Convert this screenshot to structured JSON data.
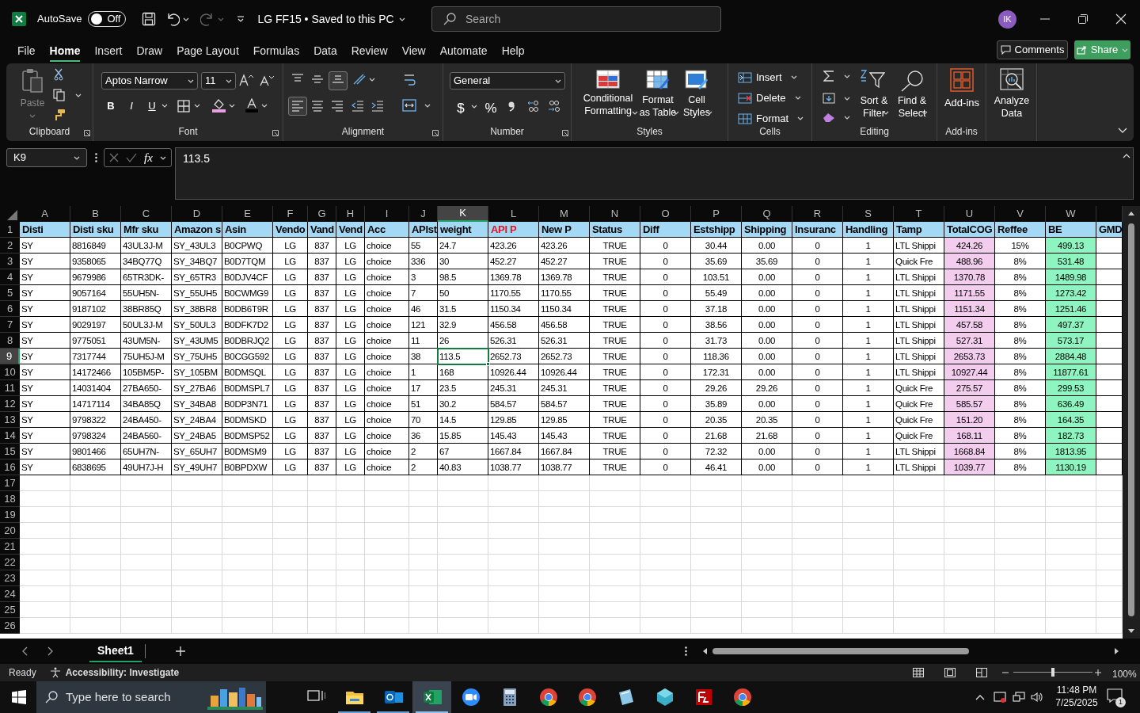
{
  "title_bar": {
    "autosave_label": "AutoSave",
    "autosave": {
      "label": "Off",
      "on": false
    },
    "document_title": "LG FF15 • Saved to this PC",
    "search_placeholder": "Search",
    "user_initials": "IK"
  },
  "menu_tabs": [
    {
      "label": "File",
      "selected": false
    },
    {
      "label": "Home",
      "selected": true
    },
    {
      "label": "Insert",
      "selected": false
    },
    {
      "label": "Draw",
      "selected": false
    },
    {
      "label": "Page Layout",
      "selected": false
    },
    {
      "label": "Formulas",
      "selected": false
    },
    {
      "label": "Data",
      "selected": false
    },
    {
      "label": "Review",
      "selected": false
    },
    {
      "label": "View",
      "selected": false
    },
    {
      "label": "Automate",
      "selected": false
    },
    {
      "label": "Help",
      "selected": false
    }
  ],
  "comments_button": "Comments",
  "share_button": "Share",
  "ribbon": {
    "clipboard": {
      "paste": "Paste",
      "label": "Clipboard"
    },
    "font": {
      "name": "Aptos Narrow",
      "size": "11",
      "bold": "B",
      "italic": "I",
      "underline": "U",
      "label": "Font"
    },
    "alignment": {
      "label": "Alignment"
    },
    "number": {
      "format": "General",
      "currency": "$",
      "percent": "%",
      "label": "Number"
    },
    "styles": {
      "buttons": [
        "Conditional Formatting",
        "Format as Table",
        "Cell Styles"
      ],
      "label": "Styles"
    },
    "cells": {
      "buttons": [
        "Insert",
        "Delete",
        "Format"
      ],
      "label": "Cells"
    },
    "editing": {
      "buttons": [
        "Sort & Filter",
        "Find & Select"
      ],
      "label": "Editing"
    },
    "addins": {
      "buttons": [
        "Add-ins"
      ],
      "label": "Add-ins"
    },
    "analyze": {
      "buttons": [
        "Analyze Data"
      ]
    }
  },
  "formula_bar": {
    "name_box": "K9",
    "function_label": "fx",
    "value": "113.5"
  },
  "sheet": {
    "heading_row_number": "1",
    "columns": [
      {
        "letter": "A",
        "heading": "Disti",
        "selected": false
      },
      {
        "letter": "B",
        "heading": "Disti sku",
        "selected": false
      },
      {
        "letter": "C",
        "heading": "Mfr sku",
        "selected": false
      },
      {
        "letter": "D",
        "heading": "Amazon s",
        "selected": false
      },
      {
        "letter": "E",
        "heading": "Asin",
        "selected": false
      },
      {
        "letter": "F",
        "heading": "Vendo",
        "selected": false
      },
      {
        "letter": "G",
        "heading": "Vand",
        "selected": false
      },
      {
        "letter": "H",
        "heading": "Vend",
        "selected": false
      },
      {
        "letter": "I",
        "heading": "Acc",
        "selected": false
      },
      {
        "letter": "J",
        "heading": "APIst",
        "selected": false
      },
      {
        "letter": "K",
        "heading": "weight",
        "selected": true
      },
      {
        "letter": "L",
        "heading": "API P",
        "selected": false,
        "highlighted": true
      },
      {
        "letter": "M",
        "heading": "New P",
        "selected": false
      },
      {
        "letter": "N",
        "heading": "Status",
        "selected": false
      },
      {
        "letter": "O",
        "heading": "Diff",
        "selected": false
      },
      {
        "letter": "P",
        "heading": "Estshipp",
        "selected": false
      },
      {
        "letter": "Q",
        "heading": "Shipping",
        "selected": false
      },
      {
        "letter": "R",
        "heading": "Insuranc",
        "selected": false
      },
      {
        "letter": "S",
        "heading": "Handling",
        "selected": false
      },
      {
        "letter": "T",
        "heading": "Tamp",
        "selected": false
      },
      {
        "letter": "U",
        "heading": "TotalCOG",
        "selected": false,
        "color": "#f2cdee"
      },
      {
        "letter": "V",
        "heading": "Reffee",
        "selected": false
      },
      {
        "letter": "W",
        "heading": "BE",
        "selected": false,
        "color": "#8ef5c0"
      },
      {
        "heading": "GMD",
        "selected": false
      }
    ],
    "rows": [
      {
        "number": "2",
        "selected": false,
        "cells": [
          "SY",
          "8816849",
          "43UL3J-M",
          "SY_43UL3",
          "B0CPWQ",
          "LG",
          "837",
          "LG",
          "choice",
          "55",
          "24.7",
          "423.26",
          "423.26",
          "TRUE",
          "0",
          "30.44",
          "0.00",
          "0",
          "1",
          "LTL Shippi",
          "424.26",
          "15%",
          "499.13"
        ]
      },
      {
        "number": "3",
        "selected": false,
        "cells": [
          "SY",
          "9358065",
          "34BQ77Q",
          "SY_34BQ7",
          "B0D7TQM",
          "LG",
          "837",
          "LG",
          "choice",
          "336",
          "30",
          "452.27",
          "452.27",
          "TRUE",
          "0",
          "35.69",
          "35.69",
          "0",
          "1",
          "Quick Fre",
          "488.96",
          "8%",
          "531.48"
        ]
      },
      {
        "number": "4",
        "selected": false,
        "cells": [
          "SY",
          "9679986",
          "65TR3DK-",
          "SY_65TR3",
          "B0DJV4CF",
          "LG",
          "837",
          "LG",
          "choice",
          "3",
          "98.5",
          "1369.78",
          "1369.78",
          "TRUE",
          "0",
          "103.51",
          "0.00",
          "0",
          "1",
          "LTL Shippi",
          "1370.78",
          "8%",
          "1489.98"
        ]
      },
      {
        "number": "5",
        "selected": false,
        "cells": [
          "SY",
          "9057164",
          "55UH5N-",
          "SY_55UH5",
          "B0CWMG9",
          "LG",
          "837",
          "LG",
          "choice",
          "7",
          "50",
          "1170.55",
          "1170.55",
          "TRUE",
          "0",
          "55.49",
          "0.00",
          "0",
          "1",
          "LTL Shippi",
          "1171.55",
          "8%",
          "1273.42"
        ]
      },
      {
        "number": "6",
        "selected": false,
        "cells": [
          "SY",
          "9187102",
          "38BR85Q",
          "SY_38BR8",
          "B0DB6T9R",
          "LG",
          "837",
          "LG",
          "choice",
          "46",
          "31.5",
          "1150.34",
          "1150.34",
          "TRUE",
          "0",
          "37.18",
          "0.00",
          "0",
          "1",
          "LTL Shippi",
          "1151.34",
          "8%",
          "1251.46"
        ]
      },
      {
        "number": "7",
        "selected": false,
        "cells": [
          "SY",
          "9029197",
          "50UL3J-M",
          "SY_50UL3",
          "B0DFK7D2",
          "LG",
          "837",
          "LG",
          "choice",
          "121",
          "32.9",
          "456.58",
          "456.58",
          "TRUE",
          "0",
          "38.56",
          "0.00",
          "0",
          "1",
          "LTL Shippi",
          "457.58",
          "8%",
          "497.37"
        ]
      },
      {
        "number": "8",
        "selected": false,
        "cells": [
          "SY",
          "9775051",
          "43UM5N-",
          "SY_43UM5",
          "B0DBRJQ2",
          "LG",
          "837",
          "LG",
          "choice",
          "11",
          "26",
          "526.31",
          "526.31",
          "TRUE",
          "0",
          "31.73",
          "0.00",
          "0",
          "1",
          "LTL Shippi",
          "527.31",
          "8%",
          "573.17"
        ]
      },
      {
        "number": "9",
        "selected": true,
        "cells": [
          "SY",
          "7317744",
          "75UH5J-M",
          "SY_75UH5",
          "B0CGG592",
          "LG",
          "837",
          "LG",
          "choice",
          "38",
          "113.5",
          "2652.73",
          "2652.73",
          "TRUE",
          "0",
          "118.36",
          "0.00",
          "0",
          "1",
          "LTL Shippi",
          "2653.73",
          "8%",
          "2884.48"
        ]
      },
      {
        "number": "10",
        "selected": false,
        "cells": [
          "SY",
          "14172466",
          "105BM5P-",
          "SY_105BM",
          "B0DMSQL",
          "LG",
          "837",
          "LG",
          "choice",
          "1",
          "168",
          "10926.44",
          "10926.44",
          "TRUE",
          "0",
          "172.31",
          "0.00",
          "0",
          "1",
          "LTL Shippi",
          "10927.44",
          "8%",
          "11877.61"
        ]
      },
      {
        "number": "11",
        "selected": false,
        "cells": [
          "SY",
          "14031404",
          "27BA650-",
          "SY_27BA6",
          "B0DMSPL7",
          "LG",
          "837",
          "LG",
          "choice",
          "17",
          "23.5",
          "245.31",
          "245.31",
          "TRUE",
          "0",
          "29.26",
          "29.26",
          "0",
          "1",
          "Quick Fre",
          "275.57",
          "8%",
          "299.53"
        ]
      },
      {
        "number": "12",
        "selected": false,
        "cells": [
          "SY",
          "14717114",
          "34BA85Q",
          "SY_34BA8",
          "B0DP3N71",
          "LG",
          "837",
          "LG",
          "choice",
          "51",
          "30.2",
          "584.57",
          "584.57",
          "TRUE",
          "0",
          "35.89",
          "0.00",
          "0",
          "1",
          "Quick Fre",
          "585.57",
          "8%",
          "636.49"
        ]
      },
      {
        "number": "13",
        "selected": false,
        "cells": [
          "SY",
          "9798322",
          "24BA450-",
          "SY_24BA4",
          "B0DMSKD",
          "LG",
          "837",
          "LG",
          "choice",
          "70",
          "14.5",
          "129.85",
          "129.85",
          "TRUE",
          "0",
          "20.35",
          "20.35",
          "0",
          "1",
          "Quick Fre",
          "151.20",
          "8%",
          "164.35"
        ]
      },
      {
        "number": "14",
        "selected": false,
        "cells": [
          "SY",
          "9798324",
          "24BA560-",
          "SY_24BA5",
          "B0DMSP52",
          "LG",
          "837",
          "LG",
          "choice",
          "36",
          "15.85",
          "145.43",
          "145.43",
          "TRUE",
          "0",
          "21.68",
          "21.68",
          "0",
          "1",
          "Quick Fre",
          "168.11",
          "8%",
          "182.73"
        ]
      },
      {
        "number": "15",
        "selected": false,
        "cells": [
          "SY",
          "9801466",
          "65UH7N-",
          "SY_65UH7",
          "B0DMSM9",
          "LG",
          "837",
          "LG",
          "choice",
          "2",
          "67",
          "1667.84",
          "1667.84",
          "TRUE",
          "0",
          "72.32",
          "0.00",
          "0",
          "1",
          "LTL Shippi",
          "1668.84",
          "8%",
          "1813.95"
        ]
      },
      {
        "number": "16",
        "selected": false,
        "cells": [
          "SY",
          "6838695",
          "49UH7J-H",
          "SY_49UH7",
          "B0BPDXW",
          "LG",
          "837",
          "LG",
          "choice",
          "2",
          "40.83",
          "1038.77",
          "1038.77",
          "TRUE",
          "0",
          "46.41",
          "0.00",
          "0",
          "1",
          "LTL Shippi",
          "1039.77",
          "8%",
          "1130.19"
        ]
      }
    ],
    "empty_rows": [
      "17",
      "18",
      "19",
      "20",
      "21",
      "22",
      "23",
      "24",
      "25",
      "26"
    ]
  },
  "sheet_tabs": [
    {
      "label": "Sheet1",
      "selected": true
    }
  ],
  "status_bar": {
    "ready": "Ready",
    "accessibility": "Accessibility: Investigate",
    "zoom": "100%",
    "zoom_slider": {
      "level": 0.5
    }
  },
  "taskbar": {
    "search_placeholder": "Type here to search",
    "apps": [
      {
        "kind": "taskview",
        "running": false,
        "active": false
      },
      {
        "kind": "folder",
        "running": true,
        "active": false
      },
      {
        "kind": "mail",
        "running": true,
        "active": false
      },
      {
        "kind": "sheet",
        "running": true,
        "active": true
      },
      {
        "kind": "meeting",
        "running": false,
        "active": false
      },
      {
        "kind": "calculator",
        "running": false,
        "active": false
      },
      {
        "kind": "browser",
        "running": false,
        "active": false
      },
      {
        "kind": "browser",
        "running": false,
        "active": false
      },
      {
        "kind": "notes",
        "running": false,
        "active": false
      },
      {
        "kind": "cube",
        "running": false,
        "active": false
      },
      {
        "kind": "ftp",
        "running": false,
        "active": false
      },
      {
        "kind": "browser",
        "running": false,
        "active": false
      }
    ],
    "time": "11:48 PM",
    "date": "7/25/2025",
    "notifications": "1"
  }
}
